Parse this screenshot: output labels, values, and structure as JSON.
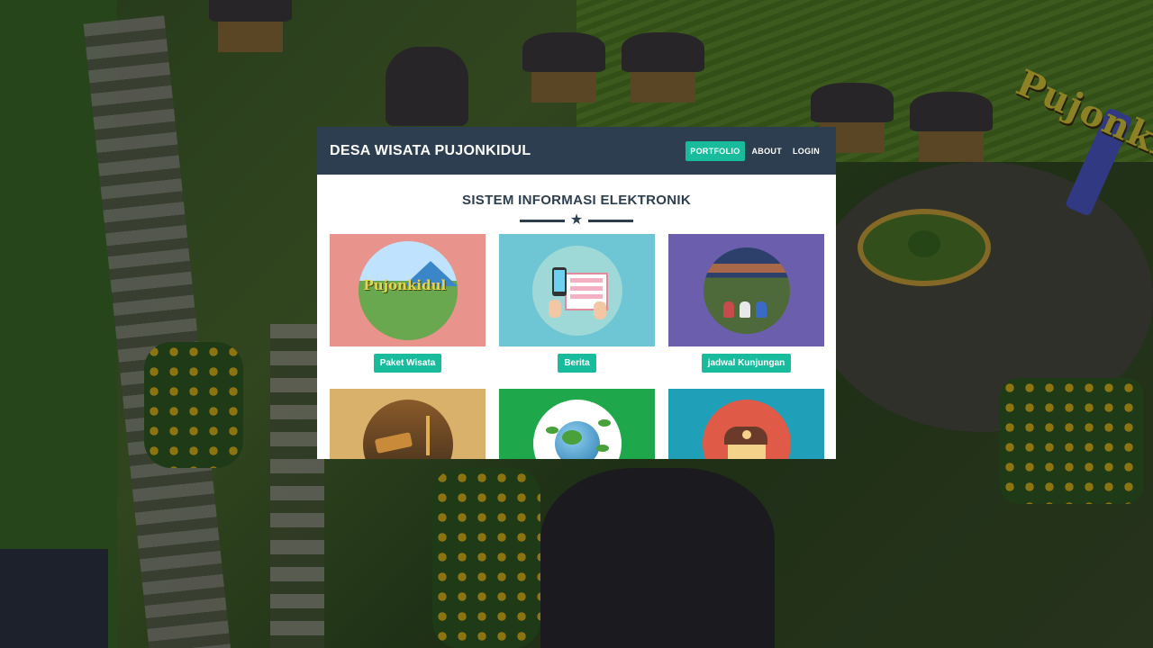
{
  "background": {
    "park_sign_text": "Pujonkidul"
  },
  "header": {
    "brand": "DESA WISATA PUJONKIDUL",
    "nav": [
      {
        "label": "PORTFOLIO",
        "active": true
      },
      {
        "label": "ABOUT",
        "active": false
      },
      {
        "label": "LOGIN",
        "active": false
      }
    ]
  },
  "main": {
    "section_title": "SISTEM INFORMASI ELEKTRONIK",
    "divider_icon": "star-icon",
    "cards": [
      {
        "label": "Paket Wisata",
        "tile_color": "#e8938b",
        "image_text": "Pujonkidul",
        "icon": "pujonkidul-logo-icon"
      },
      {
        "label": "Berita",
        "tile_color": "#6ec6d5",
        "icon": "phone-newspaper-icon"
      },
      {
        "label": "jadwal Kunjungan",
        "tile_color": "#6b5fad",
        "icon": "visitors-photo-icon"
      },
      {
        "label": "",
        "tile_color": "#d9b16a",
        "icon": "gavel-scale-icon"
      },
      {
        "label": "",
        "tile_color": "#1fa84b",
        "icon": "globe-icon"
      },
      {
        "label": "",
        "tile_color": "#1f9fb8",
        "icon": "house-icon"
      }
    ]
  },
  "colors": {
    "navbar": "#2c3e50",
    "accent": "#18bc9c",
    "title_text": "#2c3e50"
  }
}
